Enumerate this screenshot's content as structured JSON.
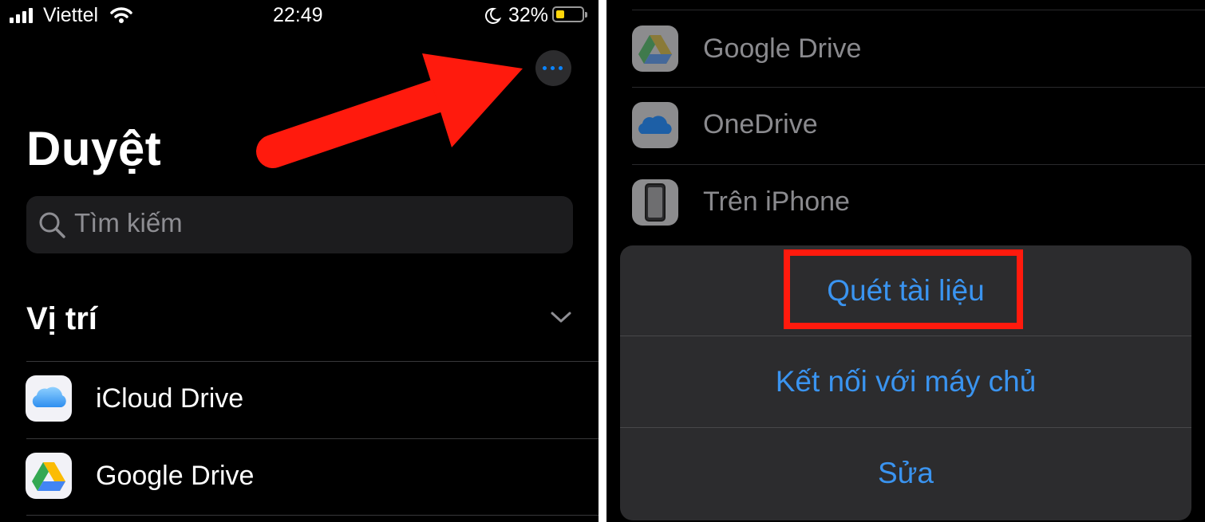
{
  "left": {
    "status": {
      "carrier": "Viettel",
      "time": "22:49",
      "battery": "32%"
    },
    "more_button_icon": "ellipsis-icon",
    "title": "Duyệt",
    "search": {
      "placeholder": "Tìm kiếm",
      "icon": "search-icon"
    },
    "section": {
      "title": "Vị trí",
      "icon": "chevron-down-icon"
    },
    "locations": [
      {
        "label": "iCloud Drive",
        "icon": "icloud-icon"
      },
      {
        "label": "Google Drive",
        "icon": "google-drive-icon"
      }
    ]
  },
  "right": {
    "locations": [
      {
        "label": "Google Drive",
        "icon": "google-drive-icon"
      },
      {
        "label": "OneDrive",
        "icon": "onedrive-icon"
      },
      {
        "label": "Trên iPhone",
        "icon": "iphone-icon"
      }
    ],
    "action_sheet": [
      {
        "label": "Quét tài liệu"
      },
      {
        "label": "Kết nối với máy chủ"
      },
      {
        "label": "Sửa"
      }
    ]
  },
  "colors": {
    "accent": "#0a84ff",
    "action_text": "#3a94f0",
    "annotation_red": "#ff1a0d"
  }
}
